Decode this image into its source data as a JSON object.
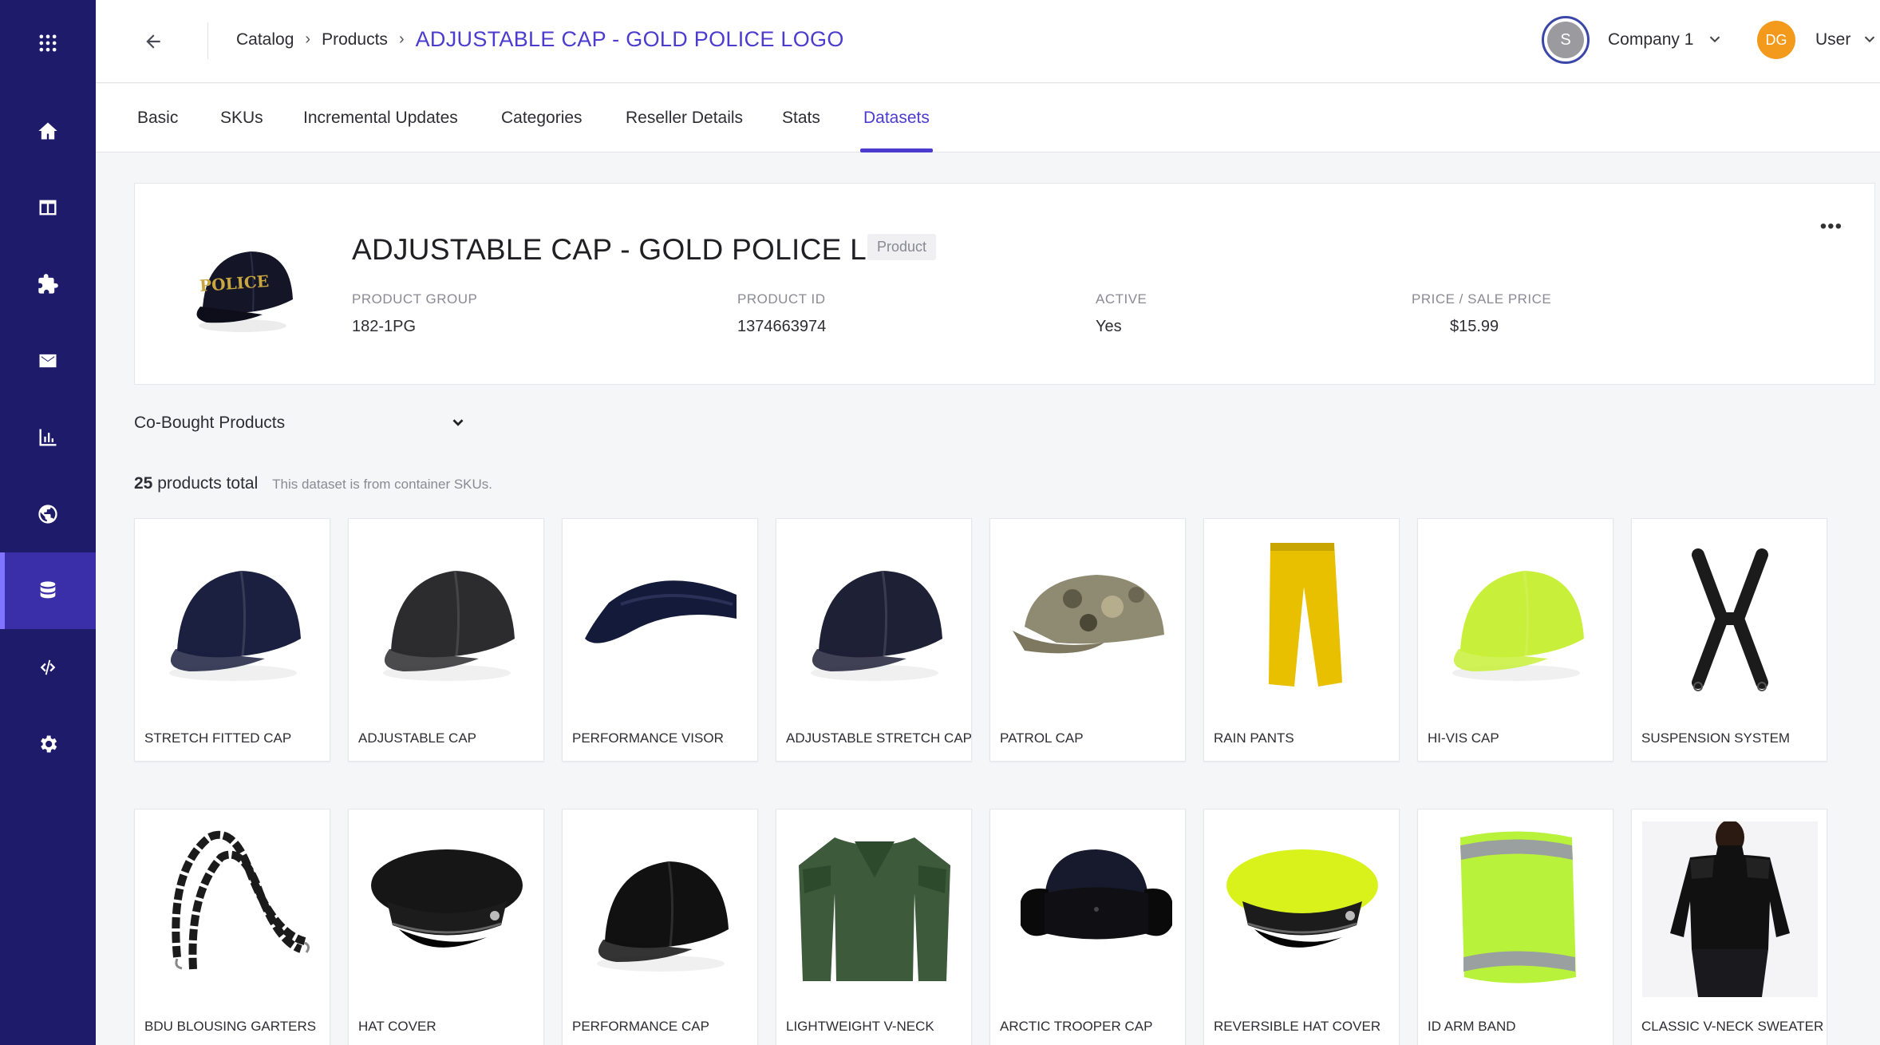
{
  "sidebar": {
    "items": [
      {
        "icon": "apps-grid-icon"
      },
      {
        "icon": "home-icon"
      },
      {
        "icon": "catalog-table-icon"
      },
      {
        "icon": "puzzle-icon"
      },
      {
        "icon": "mail-icon"
      },
      {
        "icon": "chart-icon"
      },
      {
        "icon": "globe-icon"
      },
      {
        "icon": "database-icon",
        "active": true
      },
      {
        "icon": "code-icon"
      },
      {
        "icon": "settings-icon"
      }
    ]
  },
  "header": {
    "breadcrumb": [
      "Catalog",
      "Products"
    ],
    "current": "ADJUSTABLE CAP - GOLD POLICE LOGO",
    "company_initial": "S",
    "company_name": "Company 1",
    "user_initials": "DG",
    "user_name": "User"
  },
  "tabs": [
    "Basic",
    "SKUs",
    "Incremental Updates",
    "Categories",
    "Reseller Details",
    "Stats",
    "Datasets"
  ],
  "active_tab": "Datasets",
  "product": {
    "title": "ADJUSTABLE CAP - GOLD POLICE LOGO",
    "badge": "Product",
    "logo_text": "POLICE",
    "fields": [
      {
        "label": "PRODUCT GROUP",
        "value": "182-1PG"
      },
      {
        "label": "PRODUCT ID",
        "value": "1374663974"
      },
      {
        "label": "ACTIVE",
        "value": "Yes"
      },
      {
        "label": "PRICE / SALE PRICE",
        "value": "$15.99"
      }
    ]
  },
  "dataset": {
    "selected": "Co-Bought Products",
    "total_count": "25",
    "total_suffix": "products total",
    "note": "This dataset is from container SKUs."
  },
  "products": [
    {
      "name": "STRETCH FITTED CAP",
      "icon": "cap-icon",
      "color": "#1b2040"
    },
    {
      "name": "ADJUSTABLE CAP",
      "icon": "cap-icon",
      "color": "#2c2c2e"
    },
    {
      "name": "PERFORMANCE VISOR",
      "icon": "visor-icon",
      "color": "#141a3a"
    },
    {
      "name": "ADJUSTABLE STRETCH CAP",
      "icon": "cap-icon",
      "color": "#1e2036"
    },
    {
      "name": "PATROL CAP",
      "icon": "camo-cap-icon",
      "color": "#8f8a72"
    },
    {
      "name": "RAIN PANTS",
      "icon": "pants-icon",
      "color": "#e8c000"
    },
    {
      "name": "HI-VIS CAP",
      "icon": "cap-icon",
      "color": "#c8f03a"
    },
    {
      "name": "SUSPENSION SYSTEM",
      "icon": "suspenders-icon",
      "color": "#1b1b1b"
    },
    {
      "name": "BDU BLOUSING GARTERS",
      "icon": "garters-icon",
      "color": "#1b1b1b"
    },
    {
      "name": "HAT COVER",
      "icon": "police-hat-icon",
      "color": "#161616"
    },
    {
      "name": "PERFORMANCE CAP",
      "icon": "cap-icon",
      "color": "#111111"
    },
    {
      "name": "LIGHTWEIGHT V-NECK",
      "icon": "sweater-icon",
      "color": "#3d5a3b"
    },
    {
      "name": "ARCTIC TROOPER CAP",
      "icon": "trooper-cap-icon",
      "color": "#171a2c"
    },
    {
      "name": "REVERSIBLE HAT COVER",
      "icon": "police-hat-icon",
      "color": "#d9f21c"
    },
    {
      "name": "ID ARM BAND",
      "icon": "armband-icon",
      "color": "#b9f23a"
    },
    {
      "name": "CLASSIC V-NECK SWEATER",
      "icon": "person-sweater-icon",
      "color": "#111111"
    }
  ]
}
